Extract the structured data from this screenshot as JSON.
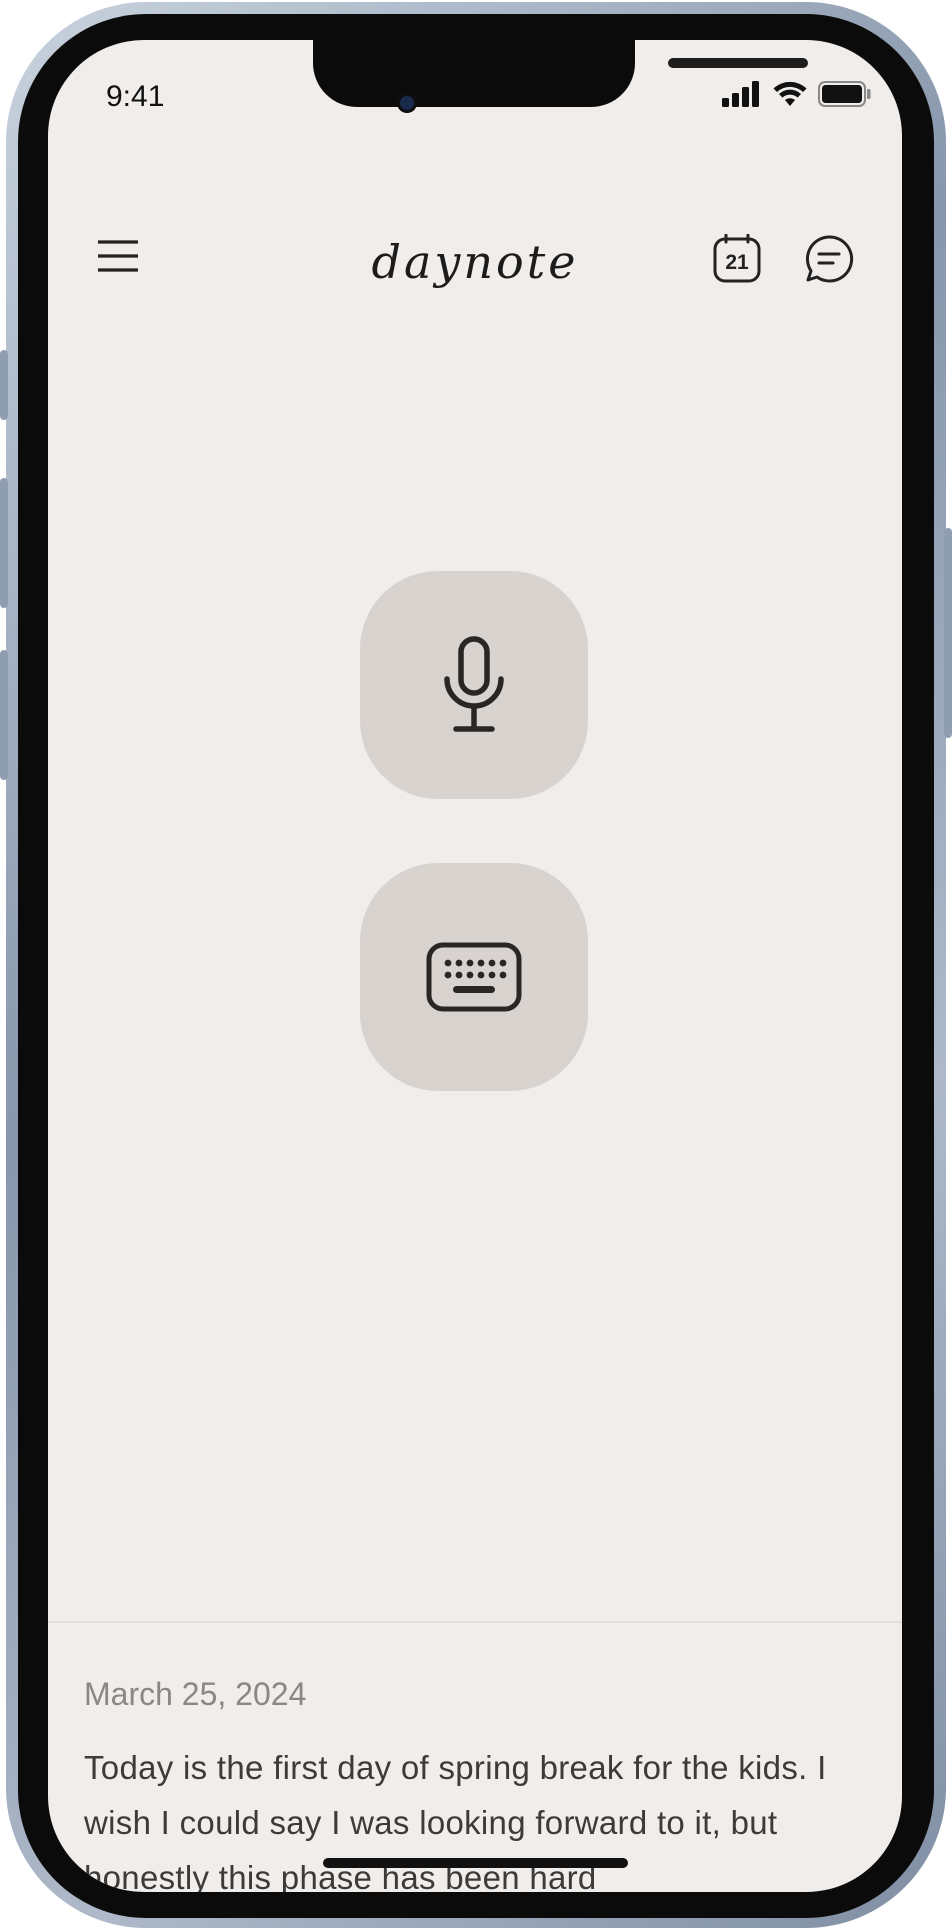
{
  "status_bar": {
    "time": "9:41"
  },
  "header": {
    "app_name": "daynote",
    "calendar_day": "21"
  },
  "entry": {
    "date": "March 25, 2024",
    "text": "Today is the first day of spring break for the kids. I wish I could say I was looking forward to it, but honestly this phase has been hard"
  },
  "icons": {
    "menu": "hamburger-menu-icon",
    "calendar": "calendar-icon",
    "chat": "chat-bubble-icon",
    "mic": "microphone-icon",
    "keyboard": "keyboard-icon"
  }
}
